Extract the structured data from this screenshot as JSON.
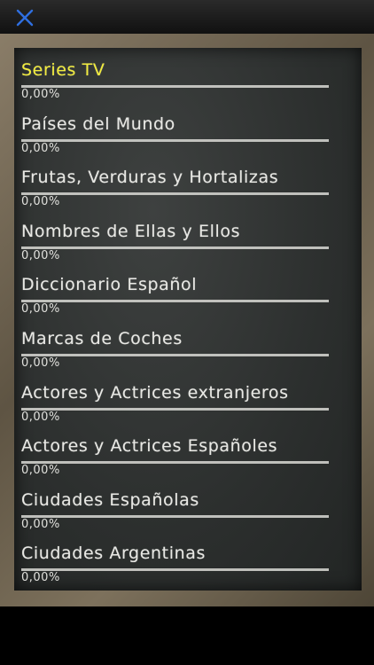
{
  "toolbar": {
    "close_icon": "close-icon",
    "accent_color": "#2f6fe0"
  },
  "colors": {
    "selected": "#f2ec3c",
    "chalk": "#e8e8e4",
    "board": "#2c2f2e",
    "frame": "#6e634f"
  },
  "categories": [
    {
      "title": "Series TV",
      "percent": "0,00%",
      "progress": 0,
      "selected": true
    },
    {
      "title": "Países del Mundo",
      "percent": "0,00%",
      "progress": 0
    },
    {
      "title": "Frutas, Verduras y Hortalizas",
      "percent": "0,00%",
      "progress": 0
    },
    {
      "title": "Nombres de Ellas y Ellos",
      "percent": "0,00%",
      "progress": 0
    },
    {
      "title": "Diccionario Español",
      "percent": "0,00%",
      "progress": 0
    },
    {
      "title": "Marcas de Coches",
      "percent": "0,00%",
      "progress": 0
    },
    {
      "title": "Actores y Actrices extranjeros",
      "percent": "0,00%",
      "progress": 0
    },
    {
      "title": "Actores y Actrices Españoles",
      "percent": "0,00%",
      "progress": 0
    },
    {
      "title": "Ciudades Españolas",
      "percent": "0,00%",
      "progress": 0
    },
    {
      "title": "Ciudades Argentinas",
      "percent": "0,00%",
      "progress": 0
    }
  ]
}
